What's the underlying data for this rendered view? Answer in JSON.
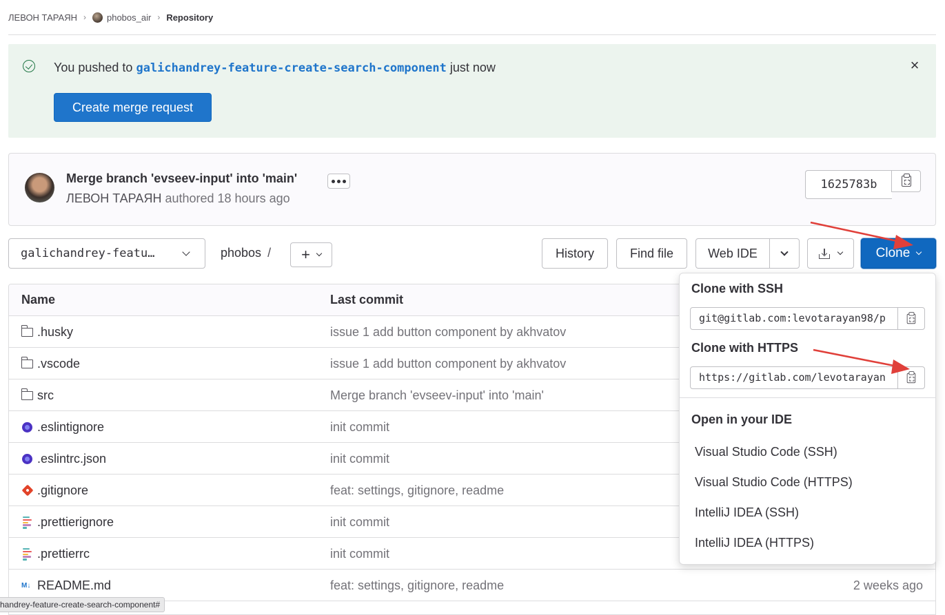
{
  "breadcrumb": {
    "owner": "ЛЕВОН ТАРАЯН",
    "project": "phobos_air",
    "current": "Repository"
  },
  "alert": {
    "prefix": "You pushed to",
    "branch": "galichandrey-feature-create-search-component",
    "suffix": "just now",
    "close": "×",
    "cta": "Create merge request"
  },
  "commit": {
    "title": "Merge branch 'evseev-input' into 'main'",
    "author": "ЛЕВОН ТАРАЯН",
    "meta": "authored 18 hours ago",
    "sha": "1625783b"
  },
  "toolbar": {
    "branch": "galichandrey-featu…",
    "path": "phobos",
    "slash": "/",
    "add": "+",
    "history": "History",
    "find_file": "Find file",
    "web_ide": "Web IDE",
    "clone": "Clone"
  },
  "table": {
    "headers": {
      "name": "Name",
      "last_commit": "Last commit"
    },
    "rows": [
      {
        "icon": "folder-icon",
        "name": ".husky",
        "commit": "issue 1 add button component by akhvatov",
        "date": ""
      },
      {
        "icon": "folder-icon",
        "name": ".vscode",
        "commit": "issue 1 add button component by akhvatov",
        "date": ""
      },
      {
        "icon": "folder-icon",
        "name": "src",
        "commit": "Merge branch 'evseev-input' into 'main'",
        "date": ""
      },
      {
        "icon": "eslint-icon",
        "name": ".eslintignore",
        "commit": "init commit",
        "date": ""
      },
      {
        "icon": "eslint-icon",
        "name": ".eslintrc.json",
        "commit": "init commit",
        "date": ""
      },
      {
        "icon": "git-icon",
        "name": ".gitignore",
        "commit": "feat: settings, gitignore, readme",
        "date": ""
      },
      {
        "icon": "prettier-icon",
        "name": ".prettierignore",
        "commit": "init commit",
        "date": ""
      },
      {
        "icon": "prettier-icon",
        "name": ".prettierrc",
        "commit": "init commit",
        "date": ""
      },
      {
        "icon": "markdown-icon",
        "name": "README.md",
        "commit": "feat: settings, gitignore, readme",
        "date": "2 weeks ago"
      }
    ]
  },
  "clone_dropdown": {
    "ssh_heading": "Clone with SSH",
    "ssh_url": "git@gitlab.com:levotarayan98/p",
    "https_heading": "Clone with HTTPS",
    "https_url": "https://gitlab.com/levotarayan",
    "ide_heading": "Open in your IDE",
    "ide_options": [
      "Visual Studio Code (SSH)",
      "Visual Studio Code (HTTPS)",
      "IntelliJ IDEA (SSH)",
      "IntelliJ IDEA (HTTPS)"
    ]
  },
  "markdown_icon_label": "M↓",
  "status_bar": "handrey-feature-create-search-component#",
  "colors": {
    "primary": "#1f75cb",
    "alert_bg": "#ecf4ee",
    "success": "#217645",
    "annotation_arrow": "#e0403a"
  }
}
